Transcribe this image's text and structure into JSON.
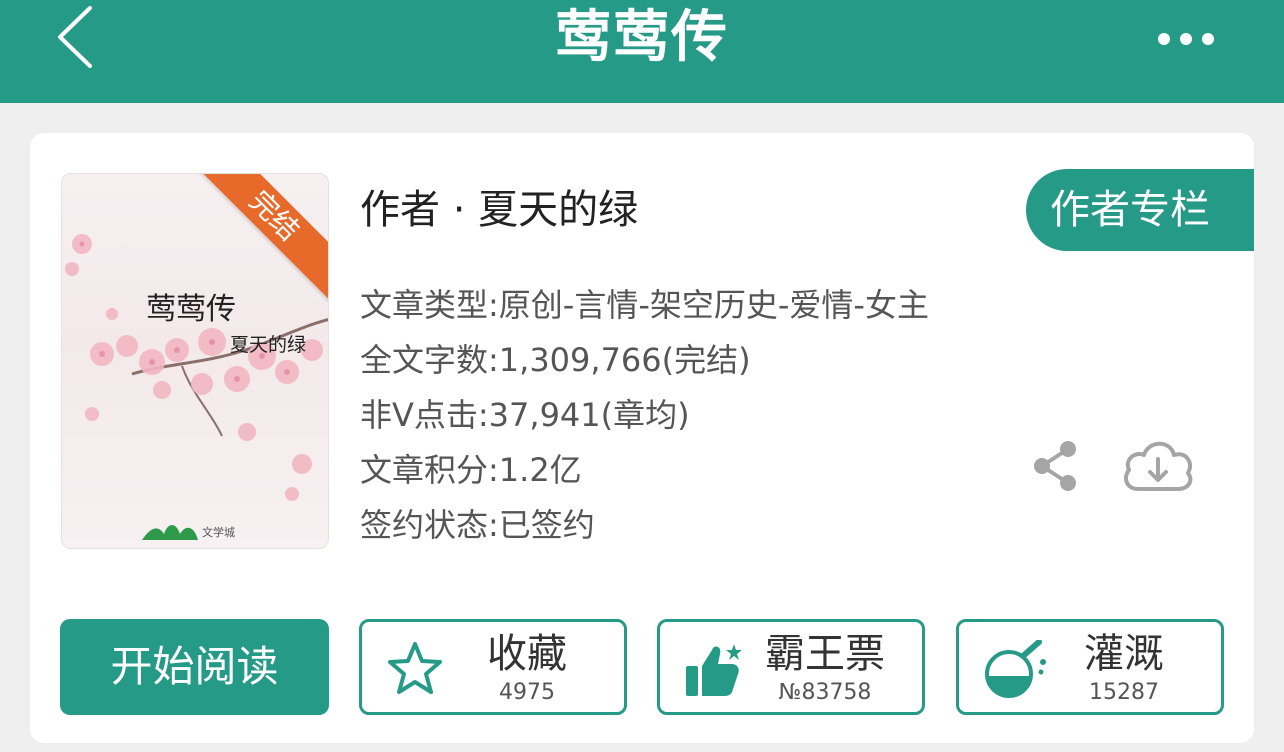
{
  "header": {
    "title": "莺莺传"
  },
  "cover": {
    "title": "莺莺传",
    "author": "夏天的绿",
    "ribbon": "完结",
    "publisher_logo_text": "文学城"
  },
  "book": {
    "author_line": "作者 · 夏天的绿",
    "author_column_label": "作者专栏",
    "info_lines": [
      "文章类型:原创-言情-架空历史-爱情-女主",
      "全文字数:1,309,766(完结)",
      "非V点击:37,941(章均)",
      "文章积分:1.2亿",
      "签约状态:已签约"
    ]
  },
  "actions": {
    "read_label": "开始阅读",
    "favorite": {
      "label": "收藏",
      "count": "4975"
    },
    "ticket": {
      "label": "霸王票",
      "count": "№83758"
    },
    "water": {
      "label": "灌溉",
      "count": "15287"
    }
  },
  "colors": {
    "primary": "#259a87",
    "ribbon": "#e86a2a",
    "icon_gray": "#a5a5a5"
  },
  "icons": {
    "back": "chevron-left-icon",
    "more": "more-dots-icon",
    "share": "share-icon",
    "download": "cloud-download-icon",
    "favorite": "star-icon",
    "ticket": "thumbs-up-icon",
    "water": "flask-icon"
  }
}
